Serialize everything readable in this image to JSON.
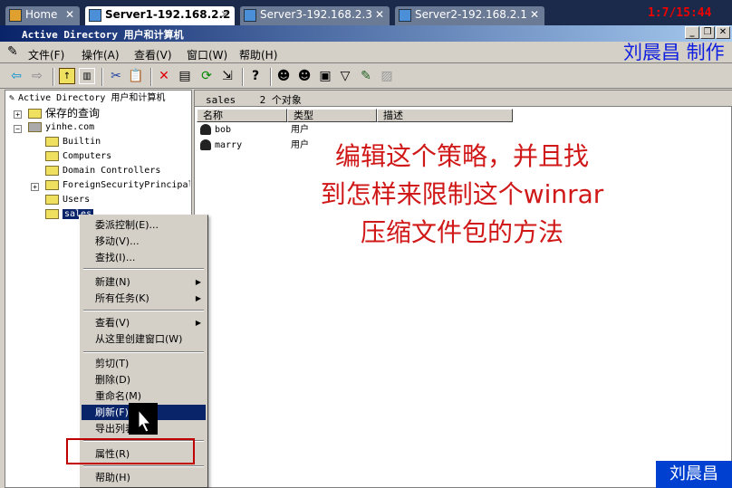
{
  "tabs": [
    {
      "label": "Home"
    },
    {
      "label": "Server1-192.168.2.2",
      "active": true
    },
    {
      "label": "Server3-192.168.2.3"
    },
    {
      "label": "Server2-192.168.2.1"
    }
  ],
  "clock": "1:7/15:44",
  "window_title": "Active Directory 用户和计算机",
  "menu": [
    "文件(F)",
    "操作(A)",
    "查看(V)",
    "窗口(W)",
    "帮助(H)"
  ],
  "toolbar_icons": [
    "back-icon",
    "forward-icon",
    "up-folder-icon",
    "show-hide-tree-icon",
    "cut-icon",
    "paste-icon",
    "delete-icon",
    "properties-icon",
    "refresh-icon",
    "export-icon",
    "help-icon",
    "new-user-icon",
    "new-group-icon",
    "new-ou-icon",
    "filter-icon",
    "find-icon",
    "add-to-group-icon"
  ],
  "tree": {
    "root": "Active Directory 用户和计算机",
    "saved": "保存的查询",
    "domain": "yinhe.com",
    "children": [
      "Builtin",
      "Computers",
      "Domain Controllers",
      "ForeignSecurityPrincipals",
      "Users",
      "sales"
    ]
  },
  "right": {
    "header_name": "sales",
    "header_count": "2 个对象",
    "columns": [
      "名称",
      "类型",
      "描述"
    ],
    "rows": [
      {
        "name": "bob",
        "type": "用户"
      },
      {
        "name": "marry",
        "type": "用户"
      }
    ]
  },
  "context_menu": [
    "委派控制(E)...",
    "移动(V)...",
    "查找(I)...",
    "新建(N)",
    "所有任务(K)",
    "查看(V)",
    "从这里创建窗口(W)",
    "剪切(T)",
    "删除(D)",
    "重命名(M)",
    "刷新(F)",
    "导出列表(L)...",
    "属性(R)",
    "帮助(H)"
  ],
  "annotation": [
    "编辑这个策略，并且找",
    "到怎样来限制这个winrar",
    "压缩文件包的方法"
  ],
  "credit": "刘晨昌 制作",
  "author_badge": "刘晨昌",
  "colors": {
    "highlight": "#0a246a",
    "annotation": "#d01818",
    "credit": "#1020e0"
  }
}
